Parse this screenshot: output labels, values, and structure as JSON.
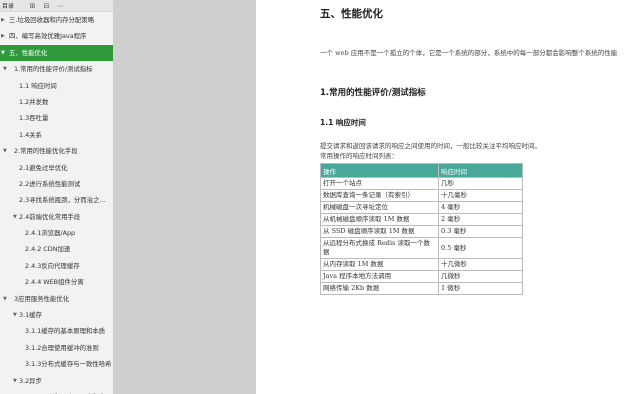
{
  "sidebar": {
    "toolbar_title": "目录",
    "items": [
      {
        "label": "三.垃圾回收器和内存分配策略",
        "indent": 0,
        "arrow": "▶",
        "active": false
      },
      {
        "label": "四、编写高效优雅Java程序",
        "indent": 0,
        "arrow": "▶",
        "active": false
      },
      {
        "label": "五、性能优化",
        "indent": 0,
        "arrow": "▼",
        "active": true
      },
      {
        "label": "1.常用的性能评价/测试指标",
        "indent": 1,
        "arrow": "▼",
        "active": false
      },
      {
        "label": "1.1 响应时间",
        "indent": 2,
        "arrow": "",
        "active": false
      },
      {
        "label": "1.2并发数",
        "indent": 2,
        "arrow": "",
        "active": false
      },
      {
        "label": "1.3吞吐量",
        "indent": 2,
        "arrow": "",
        "active": false
      },
      {
        "label": "1.4关系",
        "indent": 2,
        "arrow": "",
        "active": false
      },
      {
        "label": "2.常用的性能优化手段",
        "indent": 1,
        "arrow": "▼",
        "active": false
      },
      {
        "label": "2.1避免过早优化",
        "indent": 2,
        "arrow": "",
        "active": false
      },
      {
        "label": "2.2进行系统性能测试",
        "indent": 2,
        "arrow": "",
        "active": false
      },
      {
        "label": "2.3寻找系统瓶颈，分而治之...",
        "indent": 2,
        "arrow": "",
        "active": false
      },
      {
        "label": "2.4前端优化常用手段",
        "indent": 2,
        "arrow": "▼",
        "active": false
      },
      {
        "label": "2.4.1浏览器/App",
        "indent": 3,
        "arrow": "",
        "active": false
      },
      {
        "label": "2.4.2 CDN加速",
        "indent": 3,
        "arrow": "",
        "active": false
      },
      {
        "label": "2.4.3反向代理缓存",
        "indent": 3,
        "arrow": "",
        "active": false
      },
      {
        "label": "2.4.4 WEB组件分离",
        "indent": 3,
        "arrow": "",
        "active": false
      },
      {
        "label": "3应用服务性能优化",
        "indent": 1,
        "arrow": "▼",
        "active": false
      },
      {
        "label": "3.1缓存",
        "indent": 2,
        "arrow": "▼",
        "active": false
      },
      {
        "label": "3.1.1缓存的基本原理和本质",
        "indent": 3,
        "arrow": "",
        "active": false
      },
      {
        "label": "3.1.2合理使用缓冲的准则",
        "indent": 3,
        "arrow": "",
        "active": false
      },
      {
        "label": "3.1.3分布式缓存与一致性哈希",
        "indent": 3,
        "arrow": "",
        "active": false
      },
      {
        "label": "3.2异步",
        "indent": 2,
        "arrow": "▼",
        "active": false
      },
      {
        "label": "3.2.1同步和异步，阻塞和非...",
        "indent": 3,
        "arrow": "",
        "active": false
      }
    ]
  },
  "document": {
    "title": "五、性能优化",
    "intro": "一个 web 应用不是一个孤立的个体，它是一个系统的部分，系统中的每一部分都会影响整个系统的性能",
    "section_heading": "1.常用的性能评价/测试指标",
    "subsection_heading": "1.1  响应时间",
    "body_line1": "提交请求和返回该请求的响应之间使用的时间，一般比较关注平均响应时间。",
    "body_line2": "常用操作的响应时间列表：",
    "table": {
      "headers": [
        "操作",
        "响应时间"
      ],
      "rows": [
        [
          "打开一个站点",
          "几秒"
        ],
        [
          "数据库查询一条记录（有索引）",
          "十几毫秒"
        ],
        [
          "机械磁盘一次寻址定位",
          "4 毫秒"
        ],
        [
          "从机械磁盘顺序读取 1M 数据",
          "2 毫秒"
        ],
        [
          "从 SSD 磁盘顺序读取 1M 数据",
          "0.3 毫秒"
        ],
        [
          "从远程分布式换成 Redis 读取一个数据",
          "0.5 毫秒"
        ],
        [
          "从内存读取 1M 数据",
          "十几微秒"
        ],
        [
          "Java 程序本地方法调用",
          "几微秒"
        ],
        [
          "网络传输 2Kb 数据",
          "1 微秒"
        ]
      ]
    }
  },
  "colors": {
    "sidebar_active": "#2e9a3a",
    "table_header": "#4aa89a"
  }
}
